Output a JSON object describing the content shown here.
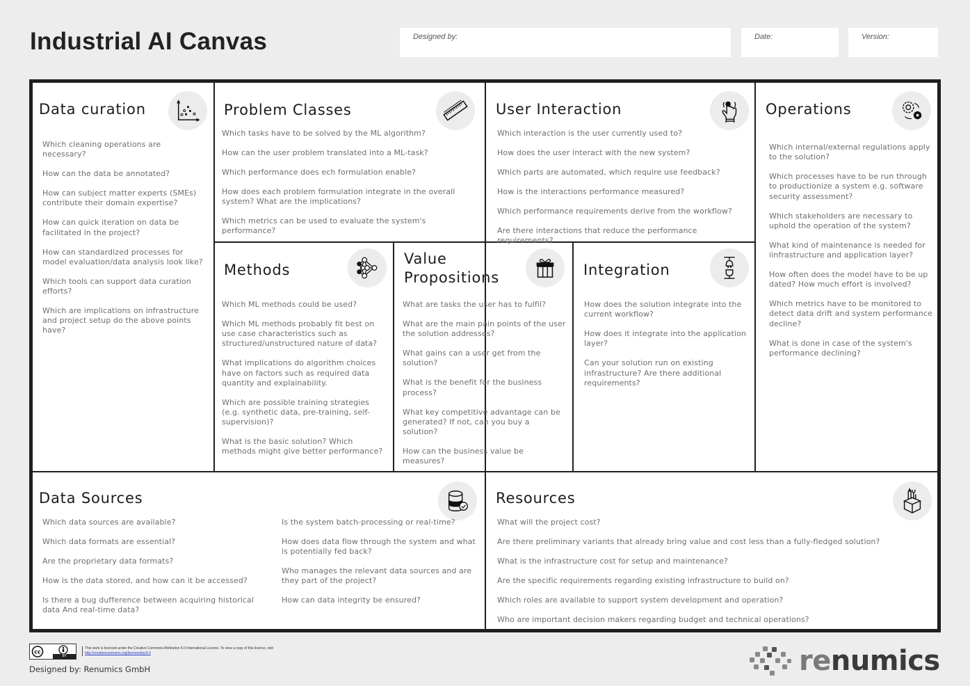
{
  "header": {
    "title": "Industrial AI Canvas",
    "designed_by_label": "Designed by:",
    "date_label": "Date:",
    "version_label": "Version:"
  },
  "cells": {
    "data_curation": {
      "title": "Data curation",
      "icon": "scatter-plot-icon",
      "questions": [
        "Which cleaning operations are necessary?",
        "How can the data be annotated?",
        "How can subject matter experts (SMEs) contribute their domain expertise?",
        "How can quick iteration on data be facilitated in the project?",
        "How can standardized processes for model evaluation/data analysis look like?",
        "Which tools can support data curation efforts?",
        "Which are implications on infrastructure and project setup do the above points have?"
      ]
    },
    "problem_classes": {
      "title": "Problem Classes",
      "icon": "ruler-icon",
      "questions": [
        "Which tasks have to be solved by the ML algorithm?",
        "How can the user problem translated into a ML-task?",
        "Which performance does ech formulation enable?",
        "How does each problem formulation integrate in the overall system? What are the implications?",
        "Which metrics can be used to evaluate the system's performance?"
      ]
    },
    "user_interaction": {
      "title": "User Interaction",
      "icon": "hand-tap-icon",
      "questions": [
        "Which interaction is the user currently used to?",
        "How does the user interact with the new system?",
        "Which parts are automated, which require use feedback?",
        "How is the interactions performance measured?",
        "Which performance requirements derive from the workflow?",
        "Are there interactions that reduce the performance requirements?"
      ]
    },
    "operations": {
      "title": "Operations",
      "icon": "gears-cycle-icon",
      "questions": [
        "Which internal/external regulations apply to the solution?",
        "Which processes have to be run through to productionize a system e.g. software security assessment?",
        "Which stakeholders are necessary to uphold the operation of the system?",
        "What kind of maintenance is needed for iinfrastructure and application layer?",
        "How often does the model have to be up dated? How much effort is involved?",
        "Which metrics have to be monitored to detect data drift and system performance decline?",
        "What is done in case of the system's performance declining?"
      ]
    },
    "methods": {
      "title": "Methods",
      "icon": "neural-network-icon",
      "questions": [
        "Which ML methods could be used?",
        "Which ML methods probably fit best on use case characteristics such as structured/unstructured nature of data?",
        "What implications do algorithm choices have on factors such as required data quantity and explainability.",
        "Which are possible training strategies (e.g. synthetic data, pre-training, self-supervision)?",
        "What is the basic solution? Which methods might give better performance?"
      ]
    },
    "value_propositions": {
      "title_line1": "Value",
      "title_line2": "Propositions",
      "icon": "gift-icon",
      "questions": [
        "What are tasks the user has to fulfil?",
        "What are the main pain points of the user the solution addresses?",
        "What gains can a user get from the solution?",
        "What is the benefit for the business process?",
        "What key competitive advantage can be generated? If not, can you buy a solution?",
        "How can the business value be measures?"
      ]
    },
    "integration": {
      "title": "Integration",
      "icon": "plug-socket-icon",
      "questions": [
        "How does the solution integrate into the current workflow?",
        "How does it integrate into the application layer?",
        "Can your solution run on existing infrastructure? Are there additional requirements?"
      ]
    },
    "data_sources": {
      "title": "Data Sources",
      "icon": "database-check-icon",
      "questions_left": [
        "Which data sources are available?",
        "Which data formats are essential?",
        "Are the proprietary data formats?",
        "How is the data stored, and how can it be accessed?",
        "Is there a bug dufference between acquiring historical data And real-time data?"
      ],
      "questions_right": [
        "Is the system batch-processing or real-time?",
        "How does data flow through the system and what is potentially fed back?",
        "Who manages the relevant data sources and are they part of the project?",
        "How can data integrity be ensured?"
      ]
    },
    "resources": {
      "title": "Resources",
      "icon": "tools-box-icon",
      "questions": [
        "What will the project cost?",
        "Are there preliminary variants that already bring value and cost less than a fully-fledged solution?",
        "What is the infrastructure cost for setup and maintenance?",
        "Are the specific requirements regarding existing infrastructure to build on?",
        "Which roles are available to support system development and operation?",
        "Who are important decision makers regarding budget and technical operations?"
      ]
    }
  },
  "footer": {
    "cc_badge_by": "BY",
    "license_text": "This work is licensed under the Creative Commons Attribution 4.0 International License. To view a copy of this license, visit ",
    "license_link": "http://creativecommons.org/licenses/by/4.0",
    "designed_by": "Designed by: Renumics GmbH",
    "logo_re": "re",
    "logo_numics": "numics"
  }
}
